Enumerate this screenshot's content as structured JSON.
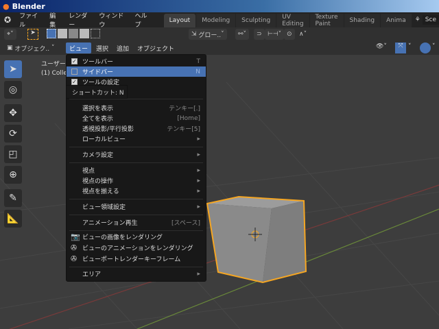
{
  "window": {
    "title": "Blender"
  },
  "topbar": {
    "menus": [
      "ファイル",
      "編集",
      "レンダー",
      "ウィンドウ",
      "ヘルプ"
    ],
    "workspaces": [
      "Layout",
      "Modeling",
      "Sculpting",
      "UV Editing",
      "Texture Paint",
      "Shading",
      "Anima"
    ],
    "scene": "Sce"
  },
  "toolheader": {
    "transform_orientation": "グロー.."
  },
  "viewheader": {
    "mode": "オブジェク..",
    "menus": [
      "ビュー",
      "選択",
      "追加",
      "オブジェクト"
    ]
  },
  "viewport": {
    "view_label": "ユーザー",
    "collection_label": "(1) Collec"
  },
  "tooltip": {
    "text": "ショートカット: N"
  },
  "view_menu": {
    "items": [
      {
        "label": "ツールバー",
        "shortcut": "T"
      },
      {
        "label": "サイドバー",
        "shortcut": "N"
      },
      {
        "label": "ツールの設定"
      },
      {
        "label": "選択を表示",
        "shortcut": "テンキー[.]"
      },
      {
        "label": "全てを表示",
        "shortcut": "[Home]"
      },
      {
        "label": "透視投影/平行投影",
        "shortcut": "テンキー[5]"
      },
      {
        "label": "ローカルビュー",
        "shortcut": "▸"
      },
      {
        "label": "カメラ設定",
        "shortcut": "▸"
      },
      {
        "label": "視点",
        "shortcut": "▸"
      },
      {
        "label": "視点の操作",
        "shortcut": "▸"
      },
      {
        "label": "視点を揃える",
        "shortcut": "▸"
      },
      {
        "label": "ビュー領域設定",
        "shortcut": "▸"
      },
      {
        "label": "アニメーション再生",
        "shortcut": "[スペース]"
      },
      {
        "label": "ビューの画像をレンダリング"
      },
      {
        "label": "ビューのアニメーションをレンダリング"
      },
      {
        "label": "ビューポートレンダーキーフレーム"
      },
      {
        "label": "エリア",
        "shortcut": "▸"
      }
    ]
  },
  "colors": {
    "accent": "#4772b3",
    "selection": "#f5a623",
    "viewport": "#3d3d3d"
  }
}
